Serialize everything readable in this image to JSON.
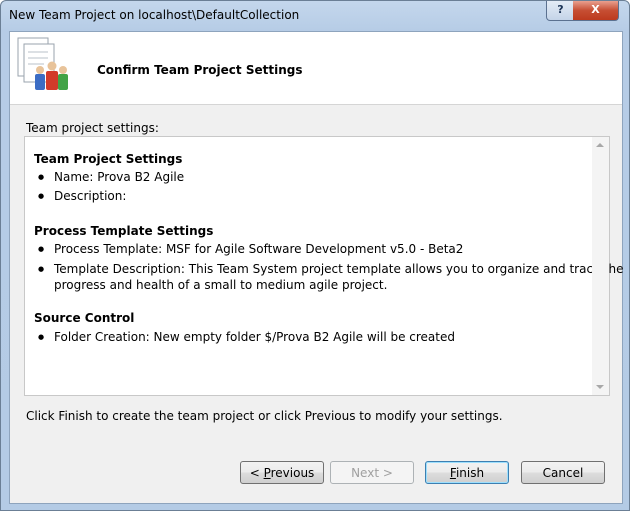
{
  "window": {
    "title": "New Team Project on localhost\\DefaultCollection",
    "help_label": "?",
    "close_label": "X"
  },
  "header": {
    "title": "Confirm Team Project Settings"
  },
  "section_label": "Team project settings:",
  "summary": {
    "team_settings": {
      "heading": "Team Project Settings",
      "items": [
        "Name: Prova B2 Agile",
        "Description:"
      ]
    },
    "process_settings": {
      "heading": "Process Template Settings",
      "items": [
        "Process Template: MSF for Agile Software Development v5.0 - Beta2",
        "Template Description: This Team System project template allows you to organize and track the",
        "progress and health of a small to medium agile project."
      ]
    },
    "source_control": {
      "heading": "Source Control",
      "items": [
        "Folder Creation: New empty folder $/Prova B2 Agile will be created"
      ]
    }
  },
  "footer_text": "Click Finish to create the team project or click Previous to modify your settings.",
  "buttons": {
    "previous_prefix": "< ",
    "previous_mnemonic": "P",
    "previous_rest": "revious",
    "next_label": "Next >",
    "finish_mnemonic": "F",
    "finish_rest": "inish",
    "cancel_label": "Cancel"
  },
  "colors": {
    "title_bar": "#b6cce6",
    "close_button": "#c64e33",
    "client_bg": "#f0f0f0"
  }
}
